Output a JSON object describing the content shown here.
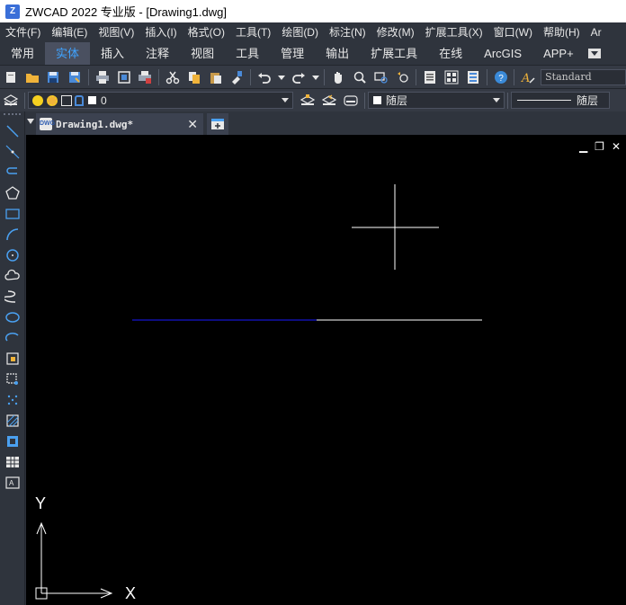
{
  "window": {
    "title": "ZWCAD 2022 专业版 - [Drawing1.dwg]",
    "app_icon_glyph": "Z"
  },
  "menubar": {
    "items": [
      "文件(F)",
      "编辑(E)",
      "视图(V)",
      "插入(I)",
      "格式(O)",
      "工具(T)",
      "绘图(D)",
      "标注(N)",
      "修改(M)",
      "扩展工具(X)",
      "窗口(W)",
      "帮助(H)",
      "Ar"
    ]
  },
  "ribbon": {
    "tabs": [
      "常用",
      "实体",
      "插入",
      "注释",
      "视图",
      "工具",
      "管理",
      "输出",
      "扩展工具",
      "在线",
      "ArcGIS",
      "APP+"
    ],
    "active_tab": "实体",
    "active_color": "#3fa3ff"
  },
  "toolbar": {
    "text_style": "Standard"
  },
  "layer_bar": {
    "current_layer": "0",
    "color_value": "随层",
    "linetype_value": "随层"
  },
  "document": {
    "tab_name": "Drawing1.dwg*",
    "tab_icon_label": "DWG"
  },
  "canvas": {
    "background": "#000000",
    "axis_x_label": "X",
    "axis_y_label": "Y",
    "window_controls": [
      "minimize-icon",
      "restore-icon",
      "close-icon"
    ]
  },
  "lefttools": {
    "icons": [
      "line-icon",
      "construction-line-icon",
      "polyline-icon",
      "polygon-icon",
      "rectangle-icon",
      "arc-icon",
      "circle-icon",
      "revcloud-icon",
      "spline-icon",
      "ellipse-icon",
      "ellipse-arc-icon",
      "insert-block-icon",
      "make-block-icon",
      "point-icon",
      "hatch-icon",
      "region-icon",
      "table-icon",
      "mtext-icon"
    ]
  }
}
